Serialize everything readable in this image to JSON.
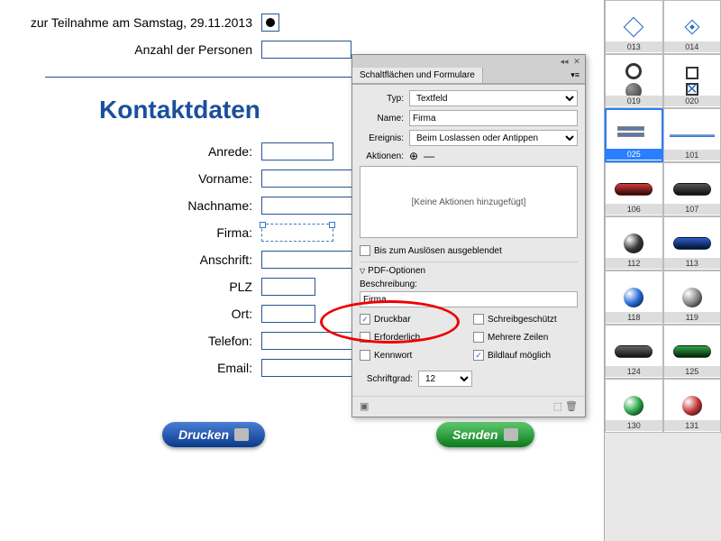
{
  "form": {
    "participation_label": "zur Teilnahme am Samstag, 29.11.2013",
    "persons_label": "Anzahl der Personen",
    "heading": "Kontaktdaten",
    "fields": {
      "anrede": "Anrede:",
      "vorname": "Vorname:",
      "nachname": "Nachname:",
      "firma": "Firma:",
      "anschrift": "Anschrift:",
      "plz": "PLZ",
      "ort": "Ort:",
      "telefon": "Telefon:",
      "email": "Email:"
    },
    "buttons": {
      "print": "Drucken",
      "send": "Senden"
    }
  },
  "panel": {
    "title": "Schaltflächen und Formulare",
    "typ_label": "Typ:",
    "typ_value": "Textfeld",
    "name_label": "Name:",
    "name_value": "Firma",
    "ereignis_label": "Ereignis:",
    "ereignis_value": "Beim Loslassen oder Antippen",
    "aktionen_label": "Aktionen:",
    "no_actions": "[Keine Aktionen hinzugefügt]",
    "hide_until": "Bis zum Auslösen ausgeblendet",
    "pdf_section": "PDF-Optionen",
    "desc_label": "Beschreibung:",
    "desc_value": "Firma",
    "opts": {
      "druckbar": "Druckbar",
      "erforderlich": "Erforderlich",
      "kennwort": "Kennwort",
      "schreibgeschuetzt": "Schreibgeschützt",
      "mehrere": "Mehrere Zeilen",
      "bildlauf": "Bildlauf möglich"
    },
    "checked": {
      "druckbar": true,
      "bildlauf": true
    },
    "schriftgrad_label": "Schriftgrad:",
    "schriftgrad_value": "12"
  },
  "library": {
    "items": [
      {
        "id": "013",
        "kind": "diamond"
      },
      {
        "id": "014",
        "kind": "diamond-fill"
      },
      {
        "id": "019",
        "kind": "ring-sq"
      },
      {
        "id": "020",
        "kind": "sq-x"
      },
      {
        "id": "025",
        "kind": "bars",
        "selected": true
      },
      {
        "id": "101",
        "kind": "line"
      },
      {
        "id": "106",
        "kind": "pill",
        "c1": "#d43a3a"
      },
      {
        "id": "107",
        "kind": "pill",
        "c1": "#555"
      },
      {
        "id": "112",
        "kind": "ball",
        "c1": "#3a3a3a"
      },
      {
        "id": "113",
        "kind": "pill",
        "c1": "#2a5fd4"
      },
      {
        "id": "118",
        "kind": "ball",
        "c1": "#2a6fd8"
      },
      {
        "id": "119",
        "kind": "ball",
        "c1": "#888"
      },
      {
        "id": "124",
        "kind": "pill",
        "c1": "#666"
      },
      {
        "id": "125",
        "kind": "pill",
        "c1": "#2fa84a"
      },
      {
        "id": "130",
        "kind": "ball",
        "c1": "#2fa84a"
      },
      {
        "id": "131",
        "kind": "ball",
        "c1": "#c43a3a"
      }
    ]
  }
}
